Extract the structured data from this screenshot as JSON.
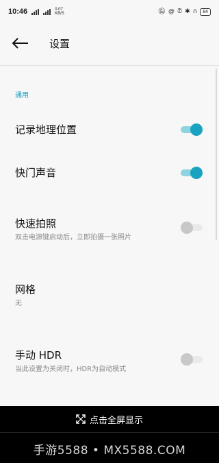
{
  "status": {
    "time": "10:46",
    "net_speed_value": "0.07",
    "net_speed_unit": "KB/S",
    "battery": "84"
  },
  "appbar": {
    "title": "设置"
  },
  "section": {
    "title": "通用"
  },
  "items": [
    {
      "title": "记录地理位置",
      "subtitle": "",
      "toggle": true
    },
    {
      "title": "快门声音",
      "subtitle": "",
      "toggle": true
    },
    {
      "title": "快速拍照",
      "subtitle": "双击电源键启动后，立即拍摄一张照片",
      "toggle": false
    },
    {
      "title": "网格",
      "subtitle": "无"
    },
    {
      "title": "手动 HDR",
      "subtitle": "当此设置为关闭时，HDR为自动模式",
      "toggle": false
    }
  ],
  "overlay": {
    "fullscreen_label": "点击全屏显示",
    "watermark": "手游5588 • MX5588.COM"
  },
  "colors": {
    "accent": "#1aa3c1",
    "background": "#f7f7f7"
  }
}
